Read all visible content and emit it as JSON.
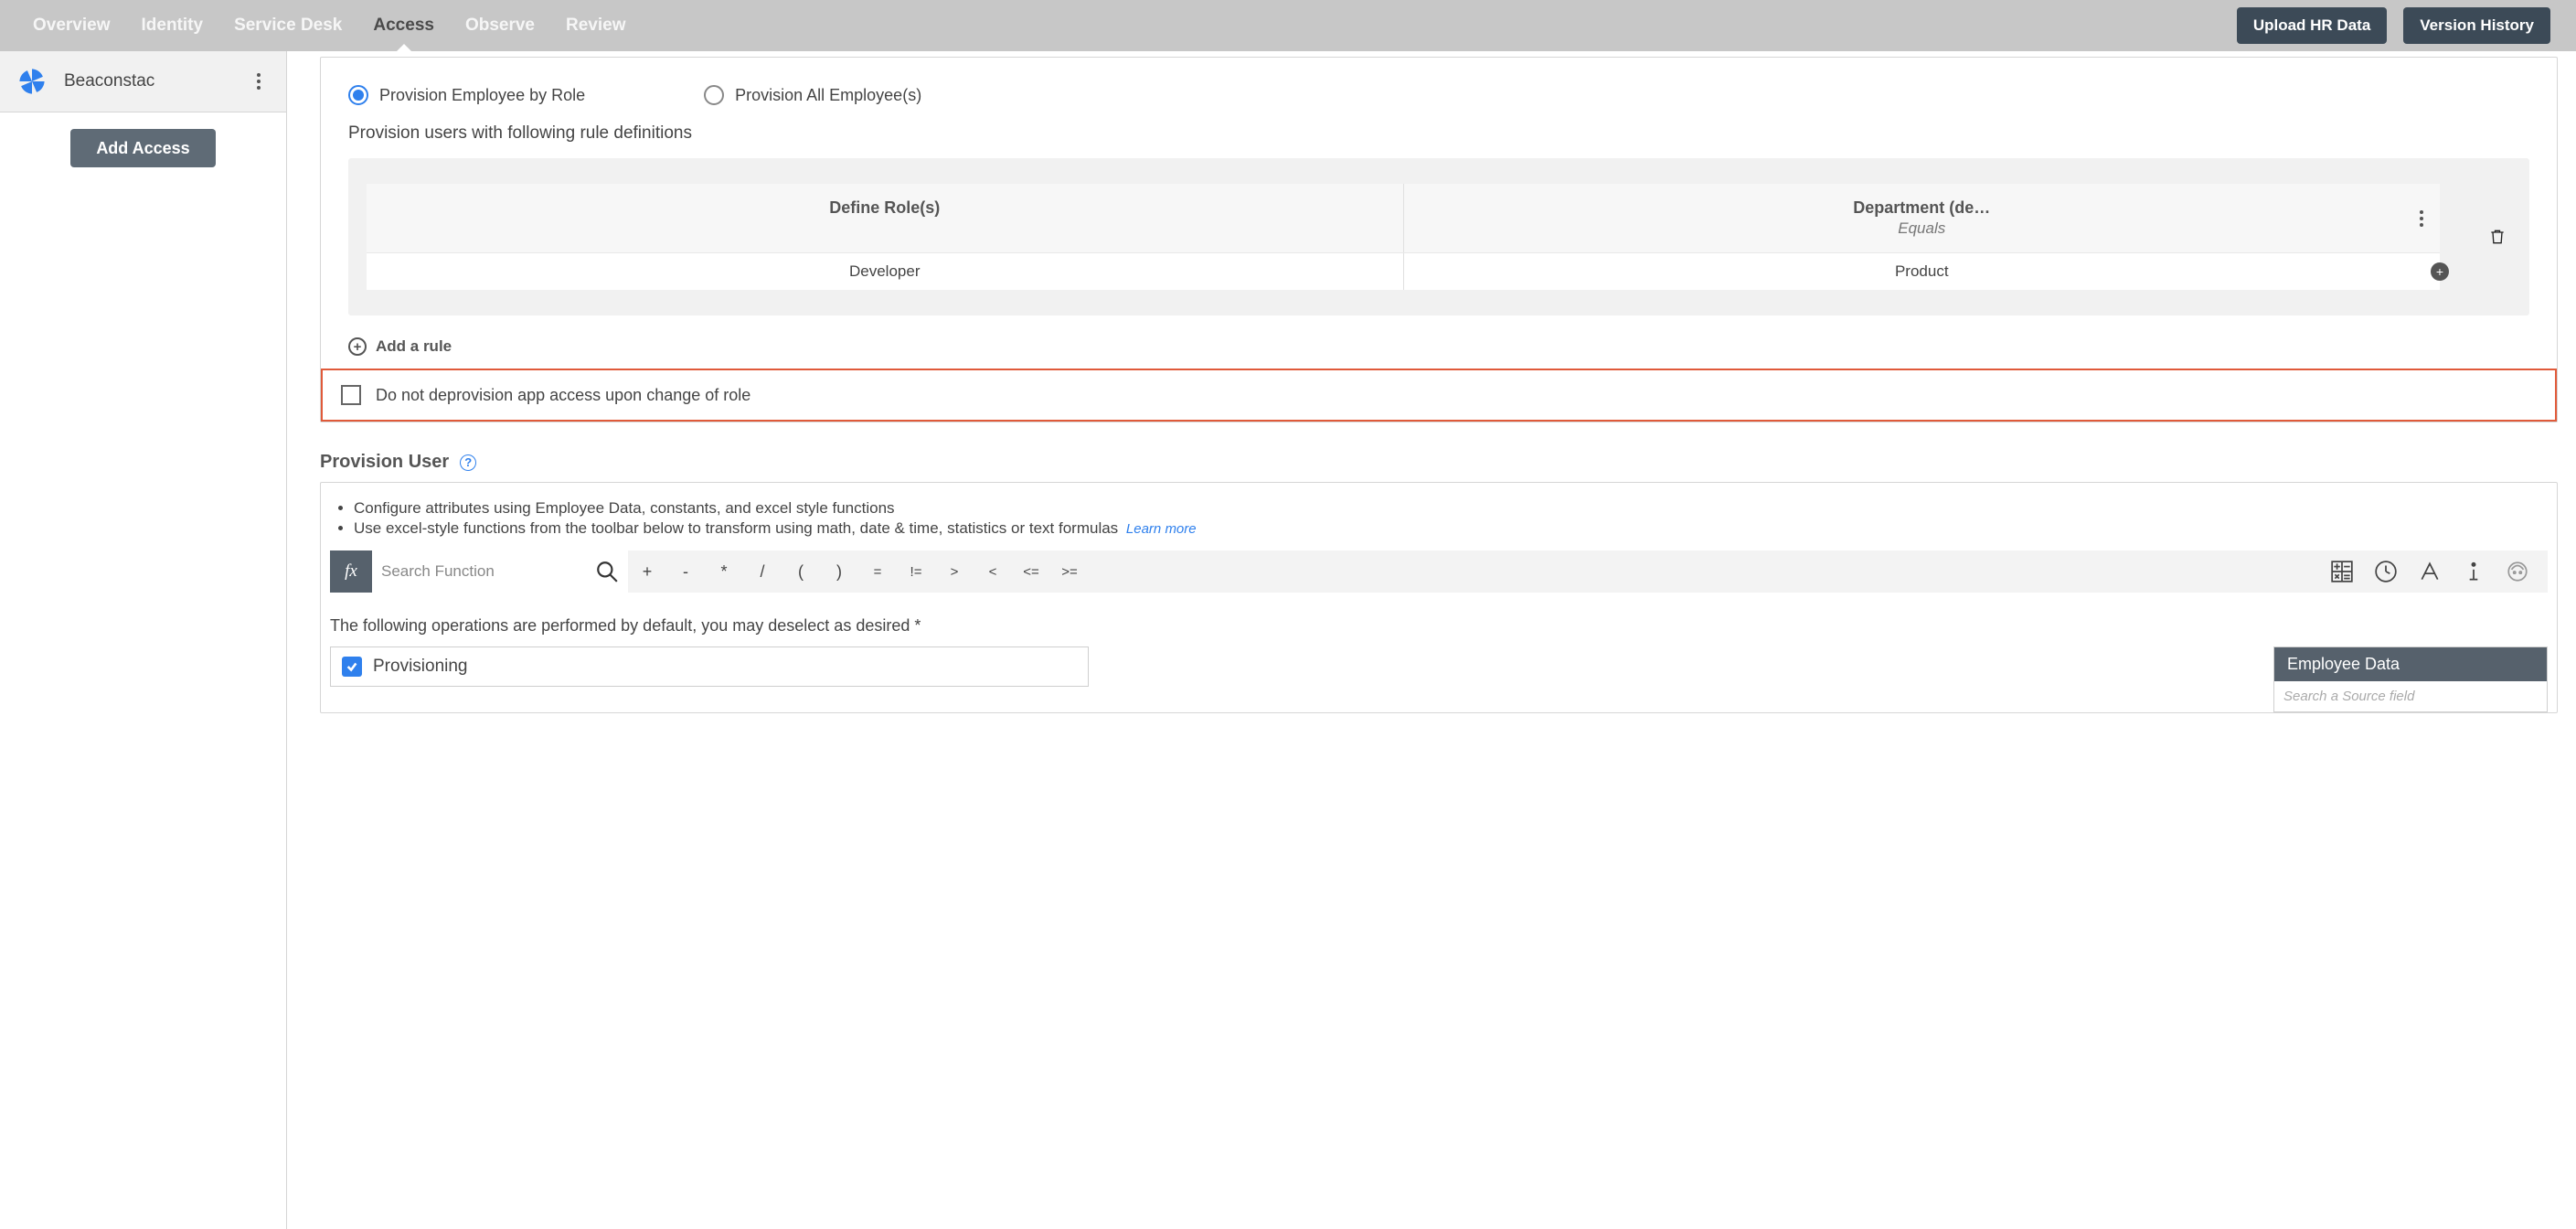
{
  "nav": {
    "tabs": [
      "Overview",
      "Identity",
      "Service Desk",
      "Access",
      "Observe",
      "Review"
    ],
    "active": "Access",
    "upload_btn": "Upload HR Data",
    "version_btn": "Version History"
  },
  "sidebar": {
    "app_name": "Beaconstac",
    "add_access_btn": "Add Access"
  },
  "access": {
    "radio_by_role": "Provision Employee by Role",
    "radio_all": "Provision All Employee(s)",
    "provision_rule_hdr": "Provision users with following rule definitions",
    "define_roles_col": "Define Role(s)",
    "dept_col_main": "Department (de…",
    "dept_col_op": "Equals",
    "role_value": "Developer",
    "dept_value": "Product",
    "add_rule": "Add a rule",
    "deprovision_chk": "Do not deprovision app access upon change of role"
  },
  "prov_user": {
    "title": "Provision User",
    "bullet1": "Configure attributes using Employee Data, constants, and excel style functions",
    "bullet2": "Use excel-style functions from the toolbar below to transform using math, date & time, statistics or text formulas",
    "learn_more": "Learn more",
    "search_placeholder": "Search Function",
    "ops": [
      "+",
      "-",
      "*",
      "/",
      "(",
      ")",
      "=",
      "!=",
      ">",
      "<",
      "<=",
      ">="
    ],
    "ops_note": "The following operations are performed by default, you may deselect as desired *",
    "provisioning_label": "Provisioning",
    "emp_data_title": "Employee Data",
    "emp_search_placeholder": "Search a Source field"
  }
}
